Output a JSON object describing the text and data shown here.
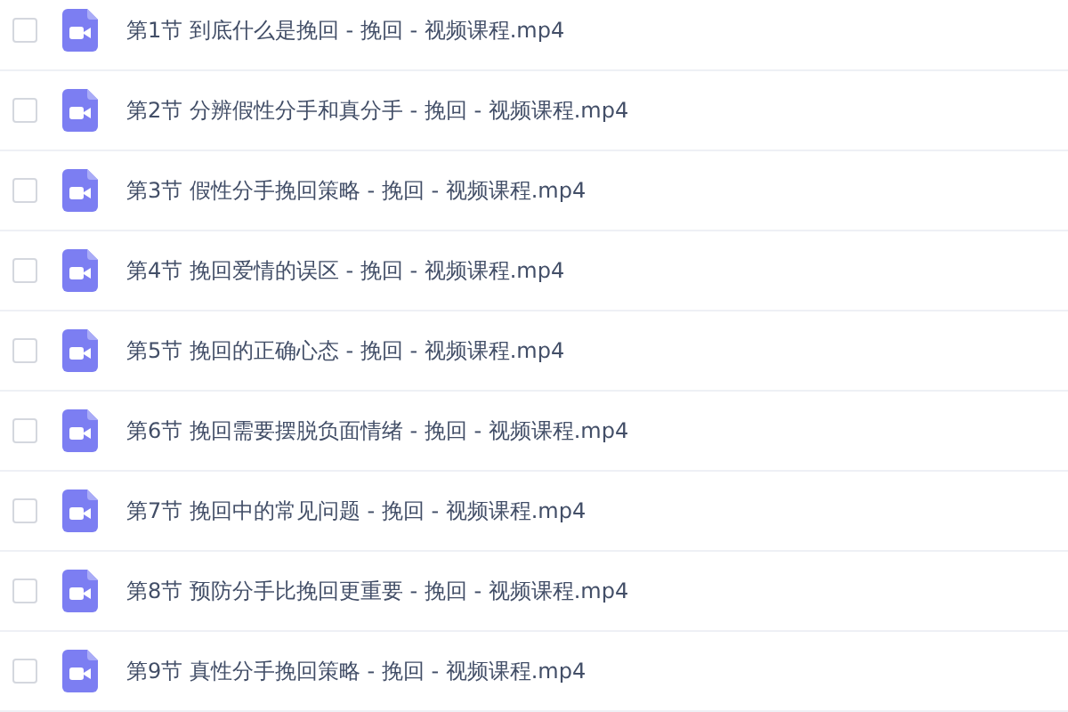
{
  "files": [
    {
      "name": "第1节 到底什么是挽回 - 挽回 - 视频课程.mp4",
      "checked": false
    },
    {
      "name": "第2节 分辨假性分手和真分手 - 挽回 - 视频课程.mp4",
      "checked": false
    },
    {
      "name": "第3节 假性分手挽回策略 - 挽回 - 视频课程.mp4",
      "checked": false
    },
    {
      "name": "第4节 挽回爱情的误区 - 挽回 - 视频课程.mp4",
      "checked": false
    },
    {
      "name": "第5节 挽回的正确心态 - 挽回 - 视频课程.mp4",
      "checked": false
    },
    {
      "name": "第6节 挽回需要摆脱负面情绪 - 挽回 - 视频课程.mp4",
      "checked": false
    },
    {
      "name": "第7节 挽回中的常见问题 - 挽回 - 视频课程.mp4",
      "checked": false
    },
    {
      "name": "第8节 预防分手比挽回更重要 - 挽回 - 视频课程.mp4",
      "checked": false
    },
    {
      "name": "第9节 真性分手挽回策略 - 挽回 - 视频课程.mp4",
      "checked": false
    }
  ]
}
